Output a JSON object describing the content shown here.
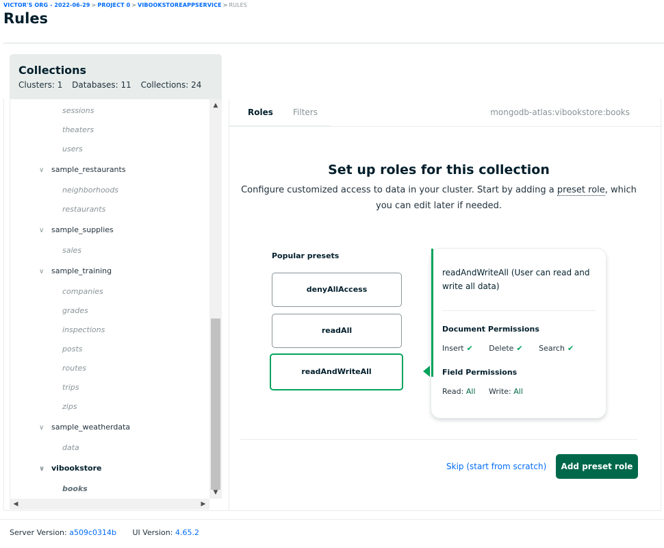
{
  "breadcrumb": {
    "items": [
      "VICTOR'S ORG - 2022-06-29",
      "PROJECT 0",
      "VIBOOKSTOREAPPSERVICE"
    ],
    "current": "RULES"
  },
  "page": {
    "title": "Rules"
  },
  "collections": {
    "title": "Collections",
    "clusters": "Clusters: 1",
    "databases": "Databases: 11",
    "collections_count": "Collections: 24"
  },
  "tree": {
    "rows": [
      {
        "type": "child",
        "label": "sessions"
      },
      {
        "type": "child",
        "label": "theaters"
      },
      {
        "type": "child",
        "label": "users"
      },
      {
        "type": "db",
        "label": "sample_restaurants"
      },
      {
        "type": "child",
        "label": "neighborhoods"
      },
      {
        "type": "child",
        "label": "restaurants"
      },
      {
        "type": "db",
        "label": "sample_supplies"
      },
      {
        "type": "child",
        "label": "sales"
      },
      {
        "type": "db",
        "label": "sample_training"
      },
      {
        "type": "child",
        "label": "companies"
      },
      {
        "type": "child",
        "label": "grades"
      },
      {
        "type": "child",
        "label": "inspections"
      },
      {
        "type": "child",
        "label": "posts"
      },
      {
        "type": "child",
        "label": "routes"
      },
      {
        "type": "child",
        "label": "trips"
      },
      {
        "type": "child",
        "label": "zips"
      },
      {
        "type": "db",
        "label": "sample_weatherdata"
      },
      {
        "type": "child",
        "label": "data"
      },
      {
        "type": "db",
        "label": "vibookstore",
        "selected": true
      },
      {
        "type": "child",
        "label": "books",
        "selected": true
      }
    ]
  },
  "tabs": {
    "roles": "Roles",
    "filters": "Filters"
  },
  "namespace": "mongodb-atlas:vibookstore:books",
  "setup": {
    "title": "Set up roles for this collection",
    "desc_part1": "Configure customized access to data in your cluster. Start by adding a ",
    "desc_link": "preset role",
    "desc_part2": ", which you can edit later if needed."
  },
  "presets": {
    "label": "Popular presets",
    "items": [
      "denyAllAccess",
      "readAll",
      "readAndWriteAll"
    ],
    "selected_index": 2
  },
  "detail": {
    "desc": "readAndWriteAll (User can read and write all data)",
    "doc_perm_title": "Document Permissions",
    "insert": "Insert",
    "delete": "Delete",
    "search": "Search",
    "field_perm_title": "Field Permissions",
    "read_label": "Read:",
    "read_value": "All",
    "write_label": "Write:",
    "write_value": "All"
  },
  "actions": {
    "skip": "Skip (start from scratch)",
    "add": "Add preset role"
  },
  "footer": {
    "server_label": "Server Version:",
    "server_value": "a509c0314b",
    "ui_label": "UI Version:",
    "ui_value": "4.65.2"
  },
  "colors": {
    "green_accent": "#00a35c",
    "green_button": "#00684a",
    "link_blue": "#016bf8"
  }
}
